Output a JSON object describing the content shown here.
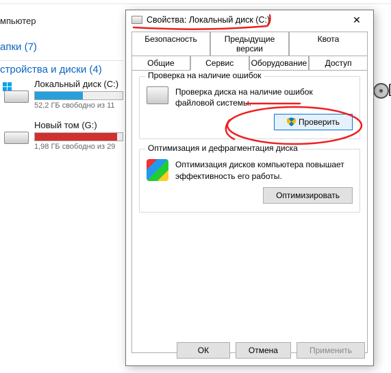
{
  "explorer": {
    "heading_partial": "мпьютер",
    "folders_label": "апки (7)",
    "devices_label": "стройства и диски (4)",
    "drives": [
      {
        "name": "Локальный диск (C:)",
        "free": "52,2 ГБ свободно из 11",
        "fill_pct": 55,
        "fill_color": "#26a0da",
        "selected": true
      },
      {
        "name": "Новый том (G:)",
        "free": "1,98 ГБ свободно из 29",
        "fill_pct": 94,
        "fill_color": "#d22f2f",
        "selected": false
      }
    ]
  },
  "dialog": {
    "title": "Свойства: Локальный диск (C:)",
    "tabs_row1": [
      "Безопасность",
      "Предыдущие версии",
      "Квота"
    ],
    "tabs_row2": [
      "Общие",
      "Сервис",
      "Оборудование",
      "Доступ"
    ],
    "active_tab": "Сервис",
    "group_check": {
      "title": "Проверка на наличие ошибок",
      "desc": "Проверка диска на наличие ошибок файловой системы.",
      "button": "Проверить"
    },
    "group_defrag": {
      "title": "Оптимизация и дефрагментация диска",
      "desc": "Оптимизация дисков компьютера повышает эффективность его работы.",
      "button": "Оптимизировать"
    },
    "buttons": {
      "ok": "ОК",
      "cancel": "Отмена",
      "apply": "Применить"
    }
  }
}
